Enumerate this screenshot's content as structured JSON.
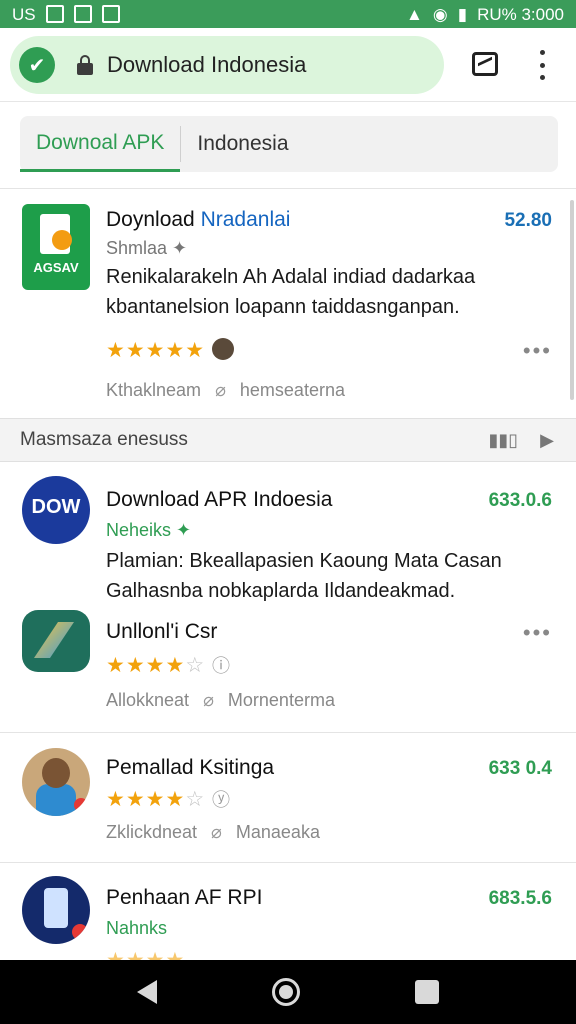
{
  "status_bar": {
    "left_icons": [
      "us-glyph",
      "image-icon",
      "download-icon",
      "image-icon"
    ],
    "left_text": "US",
    "right_text": "RU% 3:000"
  },
  "browser": {
    "url": "Download Indonesia",
    "accent": "#2f9d53",
    "pill_color": "#dcf5dc"
  },
  "tabs": [
    {
      "label": "Downoal APK",
      "active": true
    },
    {
      "label": "Indonesia",
      "active": false
    }
  ],
  "featured": {
    "icon_label": "AGSAV",
    "title_main": "Doynload ",
    "title_highlight": "Nradanlai",
    "subtitle": "Shmlaa ✦",
    "description": "Renikalarakeln Ah Adalal indiad dadarkaa kbantanelsion loapann taiddasnganpan.",
    "rating": 5,
    "size": "52.80",
    "meta_left": "Kthaklneam",
    "meta_right": "hemseaterna"
  },
  "section": {
    "title": "Masmsaza enesuss"
  },
  "apps": [
    {
      "icon_label": "DOW",
      "title": "Download APR Indoesia",
      "subtitle": "Neheiks ✦",
      "description": "Plamian: Bkeallapasien Kaoung Mata Casan Galhasnba nobkaplarda Ildandeakmad.",
      "size": "633.0.6"
    },
    {
      "title": "Unllonl'i Csr",
      "rating": 4,
      "meta_left": "Allokkneat",
      "meta_right": "Mornenterma"
    },
    {
      "title": "Pemallad Ksitinga",
      "rating": 4,
      "size": "633 0.4",
      "meta_left": "Zklickdneat",
      "meta_right": "Manaeaka"
    },
    {
      "title": "Penhaan AF RPI",
      "subtitle": "Nahnks",
      "size": "683.5.6"
    }
  ]
}
